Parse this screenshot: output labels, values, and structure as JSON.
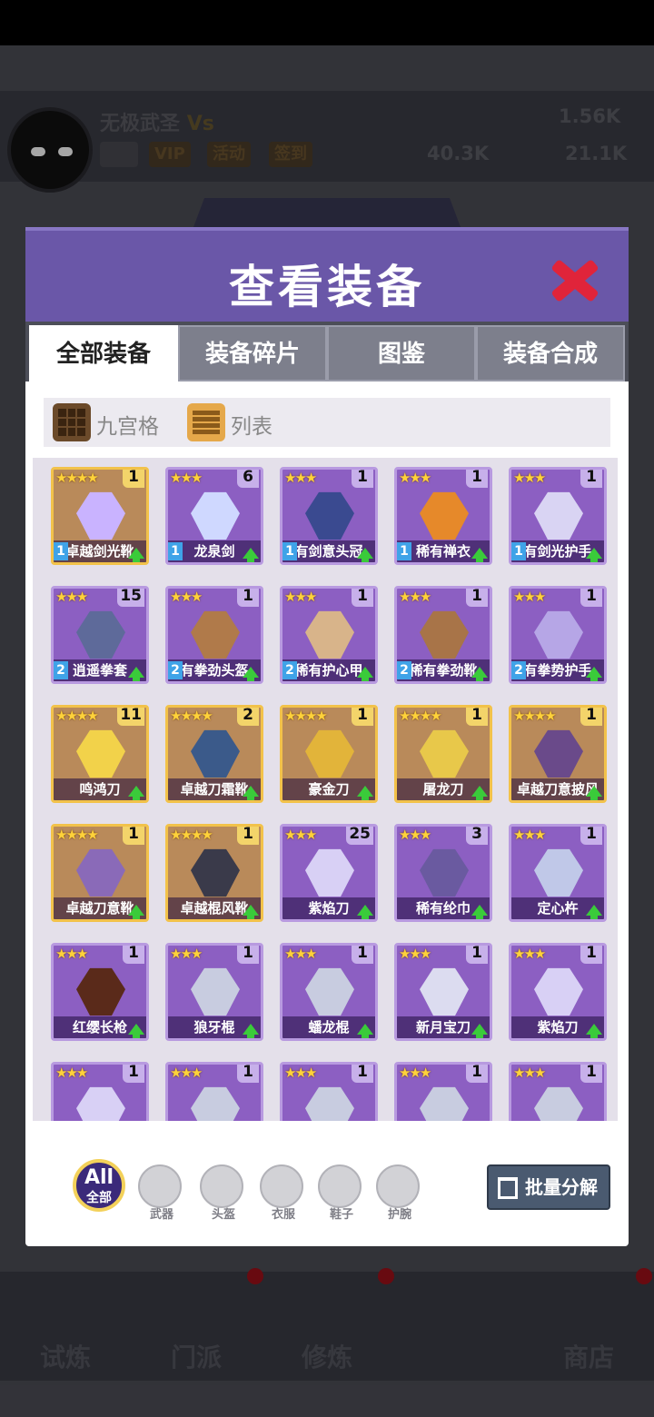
{
  "background": {
    "player_name": "无极武圣",
    "vs": "Vs",
    "vip": "VIP",
    "event": "活动",
    "checkin": "签到",
    "gems": "1.56K",
    "power": "40.3K",
    "coins": "21.1K",
    "nav": [
      "试炼",
      "门派",
      "修炼",
      "商店"
    ]
  },
  "modal": {
    "title": "查看装备",
    "tabs": [
      "全部装备",
      "装备碎片",
      "图鉴",
      "装备合成"
    ],
    "view_grid_label": "九宫格",
    "view_list_label": "列表"
  },
  "items": [
    {
      "name": "卓越剑光靴",
      "stars": "★★★★",
      "count": "1",
      "rarity": "gold",
      "level": "1",
      "color": "#c9b3ff"
    },
    {
      "name": "龙泉剑",
      "stars": "★★★",
      "count": "6",
      "rarity": "purple",
      "level": "1",
      "color": "#cfd8ff"
    },
    {
      "name": "有剑意头冠",
      "stars": "★★★",
      "count": "1",
      "rarity": "purple",
      "level": "1",
      "color": "#3a4a90"
    },
    {
      "name": "稀有禅衣",
      "stars": "★★★",
      "count": "1",
      "rarity": "purple",
      "level": "1",
      "color": "#e6892a"
    },
    {
      "name": "有剑光护手",
      "stars": "★★★",
      "count": "1",
      "rarity": "purple",
      "level": "1",
      "color": "#d9d4f3"
    },
    {
      "name": "逍遥拳套",
      "stars": "★★★",
      "count": "15",
      "rarity": "purple",
      "level": "2",
      "color": "#5e6a9a"
    },
    {
      "name": "有拳劲头盔",
      "stars": "★★★",
      "count": "1",
      "rarity": "purple",
      "level": "2",
      "color": "#b07a4a"
    },
    {
      "name": "稀有护心甲",
      "stars": "★★★",
      "count": "1",
      "rarity": "purple",
      "level": "2",
      "color": "#d8b48a"
    },
    {
      "name": "稀有拳劲靴",
      "stars": "★★★",
      "count": "1",
      "rarity": "purple",
      "level": "2",
      "color": "#a87448"
    },
    {
      "name": "有拳势护手",
      "stars": "★★★",
      "count": "1",
      "rarity": "purple",
      "level": "2",
      "color": "#b6a6e6"
    },
    {
      "name": "鸣鸿刀",
      "stars": "★★★★",
      "count": "11",
      "rarity": "gold",
      "level": "",
      "color": "#f2d24a"
    },
    {
      "name": "卓越刀霜靴",
      "stars": "★★★★",
      "count": "2",
      "rarity": "gold",
      "level": "",
      "color": "#3b5a8a"
    },
    {
      "name": "豪金刀",
      "stars": "★★★★",
      "count": "1",
      "rarity": "gold",
      "level": "",
      "color": "#e2b43a"
    },
    {
      "name": "屠龙刀",
      "stars": "★★★★",
      "count": "1",
      "rarity": "gold",
      "level": "",
      "color": "#e8c84a"
    },
    {
      "name": "卓越刀意披风",
      "stars": "★★★★",
      "count": "1",
      "rarity": "gold",
      "level": "",
      "color": "#6a4a8a"
    },
    {
      "name": "卓越刀意靴",
      "stars": "★★★★",
      "count": "1",
      "rarity": "gold",
      "level": "",
      "color": "#8a6ab8"
    },
    {
      "name": "卓越棍风靴",
      "stars": "★★★★",
      "count": "1",
      "rarity": "gold",
      "level": "",
      "color": "#3a3a4a"
    },
    {
      "name": "紫焰刀",
      "stars": "★★★",
      "count": "25",
      "rarity": "purple",
      "level": "",
      "color": "#d8d0f5"
    },
    {
      "name": "稀有纶巾",
      "stars": "★★★",
      "count": "3",
      "rarity": "purple",
      "level": "",
      "color": "#6a5aa0"
    },
    {
      "name": "定心杵",
      "stars": "★★★",
      "count": "1",
      "rarity": "purple",
      "level": "",
      "color": "#c0c8e8"
    },
    {
      "name": "红缨长枪",
      "stars": "★★★",
      "count": "1",
      "rarity": "purple",
      "level": "",
      "color": "#5a2a1a"
    },
    {
      "name": "狼牙棍",
      "stars": "★★★",
      "count": "1",
      "rarity": "purple",
      "level": "",
      "color": "#c8cce0"
    },
    {
      "name": "蟠龙棍",
      "stars": "★★★",
      "count": "1",
      "rarity": "purple",
      "level": "",
      "color": "#c8cce0"
    },
    {
      "name": "新月宝刀",
      "stars": "★★★",
      "count": "1",
      "rarity": "purple",
      "level": "",
      "color": "#dcdcf0"
    },
    {
      "name": "紫焰刀",
      "stars": "★★★",
      "count": "1",
      "rarity": "purple",
      "level": "",
      "color": "#d8d0f5"
    },
    {
      "name": "",
      "stars": "★★★",
      "count": "1",
      "rarity": "purple",
      "level": "",
      "color": "#d8d0f5"
    },
    {
      "name": "",
      "stars": "★★★",
      "count": "1",
      "rarity": "purple",
      "level": "",
      "color": "#c8cce0"
    },
    {
      "name": "",
      "stars": "★★★",
      "count": "1",
      "rarity": "purple",
      "level": "",
      "color": "#c8cce0"
    },
    {
      "name": "",
      "stars": "★★★",
      "count": "1",
      "rarity": "purple",
      "level": "",
      "color": "#c8cce0"
    },
    {
      "name": "",
      "stars": "★★★",
      "count": "1",
      "rarity": "purple",
      "level": "",
      "color": "#c8cce0"
    }
  ],
  "filters": {
    "all_top": "All",
    "all_bottom": "全部",
    "categories": [
      "武器",
      "头盔",
      "衣服",
      "鞋子",
      "护腕"
    ]
  },
  "batch_button": "批量分解"
}
